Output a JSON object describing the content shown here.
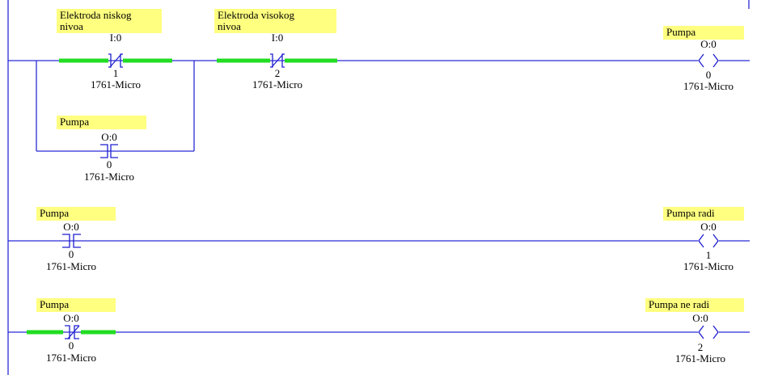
{
  "colors": {
    "wire": "#2b2bd6",
    "energized": "#22dd22",
    "note_background": "#ffff80"
  },
  "rungs": [
    {
      "contacts": [
        {
          "symbol": "Elektroda niskog nivoa",
          "address": "I:0",
          "bit": "1",
          "processor": "1761-Micro",
          "type": "XIO",
          "energized": true
        },
        {
          "symbol": "Elektroda visokog nivoa",
          "address": "I:0",
          "bit": "2",
          "processor": "1761-Micro",
          "type": "XIO",
          "energized": true
        }
      ],
      "branch_contact": {
        "symbol": "Pumpa",
        "address": "O:0",
        "bit": "0",
        "processor": "1761-Micro",
        "type": "XIC",
        "energized": false
      },
      "coil": {
        "symbol": "Pumpa",
        "address": "O:0",
        "bit": "0",
        "processor": "1761-Micro",
        "type": "OTE"
      }
    },
    {
      "contacts": [
        {
          "symbol": "Pumpa",
          "address": "O:0",
          "bit": "0",
          "processor": "1761-Micro",
          "type": "XIC",
          "energized": false
        }
      ],
      "coil": {
        "symbol": "Pumpa radi",
        "address": "O:0",
        "bit": "1",
        "processor": "1761-Micro",
        "type": "OTE"
      }
    },
    {
      "contacts": [
        {
          "symbol": "Pumpa",
          "address": "O:0",
          "bit": "0",
          "processor": "1761-Micro",
          "type": "XIO",
          "energized": true
        }
      ],
      "coil": {
        "symbol": "Pumpa ne radi",
        "address": "O:0",
        "bit": "2",
        "processor": "1761-Micro",
        "type": "OTE"
      }
    }
  ]
}
